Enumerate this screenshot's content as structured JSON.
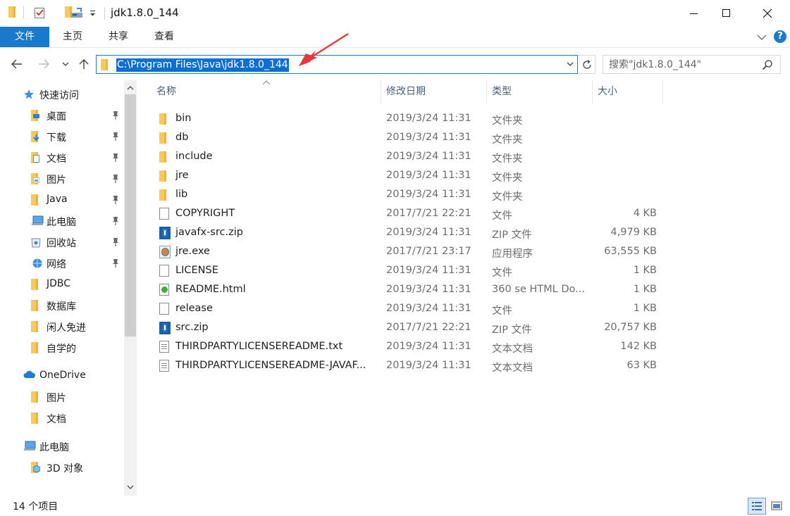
{
  "window": {
    "title": "jdk1.8.0_144"
  },
  "ribbon": {
    "tabs": [
      "文件",
      "主页",
      "共享",
      "查看"
    ]
  },
  "address": {
    "path": "C:\\Program Files\\Java\\jdk1.8.0_144"
  },
  "search": {
    "placeholder": "搜索\"jdk1.8.0_144\""
  },
  "nav": {
    "items": [
      {
        "label": "快速访问",
        "icon": "star-icon",
        "pinned": false
      },
      {
        "label": "桌面",
        "icon": "desktop-folder-icon",
        "pinned": true
      },
      {
        "label": "下载",
        "icon": "download-folder-icon",
        "pinned": true
      },
      {
        "label": "文档",
        "icon": "documents-folder-icon",
        "pinned": true
      },
      {
        "label": "图片",
        "icon": "pictures-folder-icon",
        "pinned": true
      },
      {
        "label": "Java",
        "icon": "folder-icon",
        "pinned": true
      },
      {
        "label": "此电脑",
        "icon": "computer-icon",
        "pinned": true
      },
      {
        "label": "回收站",
        "icon": "recycle-bin-icon",
        "pinned": true
      },
      {
        "label": "网络",
        "icon": "network-icon",
        "pinned": true
      },
      {
        "label": "JDBC",
        "icon": "folder-icon",
        "pinned": false
      },
      {
        "label": "数据库",
        "icon": "folder-icon",
        "pinned": false
      },
      {
        "label": "闲人免进",
        "icon": "folder-icon",
        "pinned": false
      },
      {
        "label": "自学的",
        "icon": "folder-icon",
        "pinned": false
      },
      {
        "label": "OneDrive",
        "icon": "cloud-icon",
        "pinned": false
      },
      {
        "label": "图片",
        "icon": "folder-icon",
        "pinned": false
      },
      {
        "label": "文档",
        "icon": "folder-icon",
        "pinned": false
      },
      {
        "label": "此电脑",
        "icon": "computer-icon",
        "pinned": false
      },
      {
        "label": "3D 对象",
        "icon": "3d-objects-folder-icon",
        "pinned": false
      }
    ]
  },
  "columns": {
    "name": "名称",
    "date": "修改日期",
    "type": "类型",
    "size": "大小"
  },
  "files": [
    {
      "name": "bin",
      "date": "2019/3/24 11:31",
      "type": "文件夹",
      "size": "",
      "icon": "folder-icon"
    },
    {
      "name": "db",
      "date": "2019/3/24 11:31",
      "type": "文件夹",
      "size": "",
      "icon": "folder-icon"
    },
    {
      "name": "include",
      "date": "2019/3/24 11:31",
      "type": "文件夹",
      "size": "",
      "icon": "folder-icon"
    },
    {
      "name": "jre",
      "date": "2019/3/24 11:31",
      "type": "文件夹",
      "size": "",
      "icon": "folder-icon"
    },
    {
      "name": "lib",
      "date": "2019/3/24 11:31",
      "type": "文件夹",
      "size": "",
      "icon": "folder-icon"
    },
    {
      "name": "COPYRIGHT",
      "date": "2017/7/21 22:21",
      "type": "文件",
      "size": "4 KB",
      "icon": "file-icon"
    },
    {
      "name": "javafx-src.zip",
      "date": "2019/3/24 11:31",
      "type": "ZIP 文件",
      "size": "4,979 KB",
      "icon": "zip-icon"
    },
    {
      "name": "jre.exe",
      "date": "2017/7/21 23:17",
      "type": "应用程序",
      "size": "63,555 KB",
      "icon": "exe-icon"
    },
    {
      "name": "LICENSE",
      "date": "2019/3/24 11:31",
      "type": "文件",
      "size": "1 KB",
      "icon": "file-icon"
    },
    {
      "name": "README.html",
      "date": "2019/3/24 11:31",
      "type": "360 se HTML Do...",
      "size": "1 KB",
      "icon": "html-icon"
    },
    {
      "name": "release",
      "date": "2019/3/24 11:31",
      "type": "文件",
      "size": "1 KB",
      "icon": "file-icon"
    },
    {
      "name": "src.zip",
      "date": "2017/7/21 22:21",
      "type": "ZIP 文件",
      "size": "20,757 KB",
      "icon": "zip-icon"
    },
    {
      "name": "THIRDPARTYLICENSEREADME.txt",
      "date": "2019/3/24 11:31",
      "type": "文本文档",
      "size": "142 KB",
      "icon": "text-file-icon"
    },
    {
      "name": "THIRDPARTYLICENSEREADME-JAVAF...",
      "date": "2019/3/24 11:31",
      "type": "文本文档",
      "size": "63 KB",
      "icon": "text-file-icon"
    }
  ],
  "status": {
    "item_count": "14 个项目"
  },
  "colors": {
    "accent": "#1979ca",
    "selection": "#0f6fd1",
    "annotation_arrow": "#e8393a",
    "folder": "#f6ca5b"
  }
}
